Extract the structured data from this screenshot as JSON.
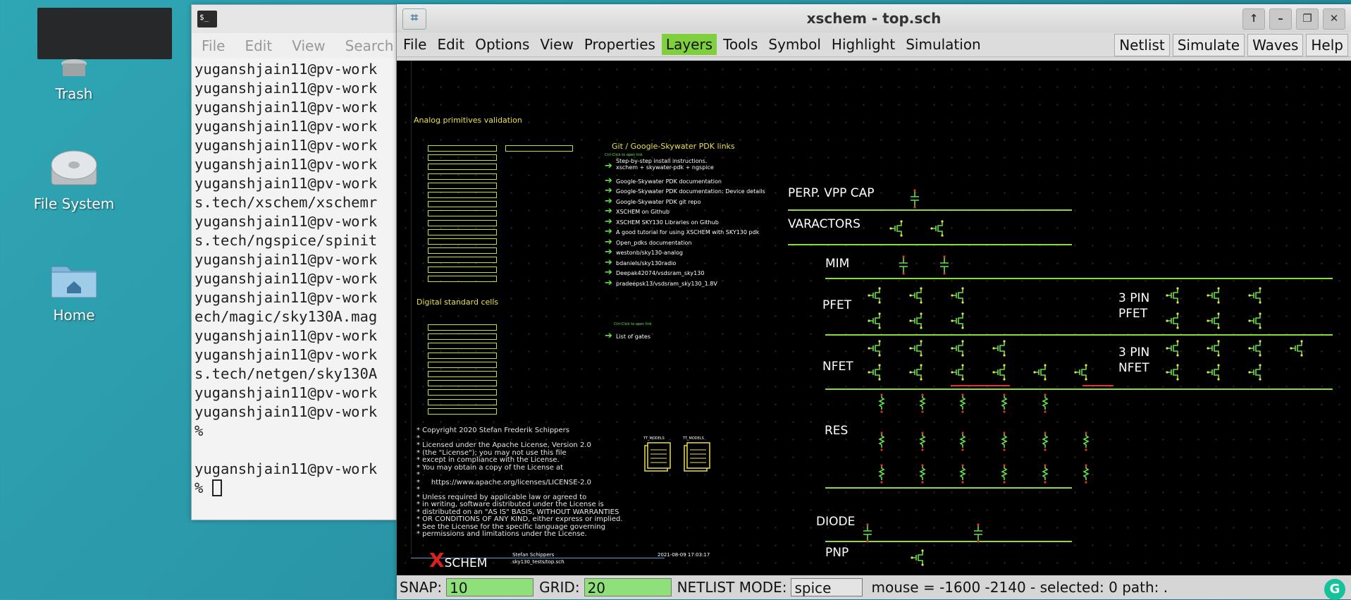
{
  "desktop": {
    "icons": [
      {
        "name": "trash-icon",
        "label": "Trash"
      },
      {
        "name": "file-system-icon",
        "label": "File System"
      },
      {
        "name": "home-folder-icon",
        "label": "Home"
      }
    ]
  },
  "terminal": {
    "menu": [
      "File",
      "Edit",
      "View",
      "Search"
    ],
    "lines": [
      "yuganshjain11@pv-work",
      "yuganshjain11@pv-work",
      "yuganshjain11@pv-work",
      "yuganshjain11@pv-work",
      "yuganshjain11@pv-work",
      "yuganshjain11@pv-work",
      "yuganshjain11@pv-work",
      "s.tech/xschem/xschemr",
      "yuganshjain11@pv-work",
      "s.tech/ngspice/spinit",
      "yuganshjain11@pv-work",
      "yuganshjain11@pv-work",
      "yuganshjain11@pv-work",
      "ech/magic/sky130A.mag",
      "yuganshjain11@pv-work",
      "yuganshjain11@pv-work",
      "s.tech/netgen/sky130A",
      "yuganshjain11@pv-work",
      "yuganshjain11@pv-work",
      "%",
      "",
      "yuganshjain11@pv-work",
      "% "
    ]
  },
  "xschem": {
    "title": "xschem - top.sch",
    "menu": [
      "File",
      "Edit",
      "Options",
      "View",
      "Properties",
      "Layers",
      "Tools",
      "Symbol",
      "Highlight",
      "Simulation"
    ],
    "active_menu": "Layers",
    "right_buttons": [
      "Netlist",
      "Simulate",
      "Waves",
      "Help"
    ],
    "status": {
      "snap_label": "SNAP:",
      "snap_value": "10",
      "grid_label": "GRID:",
      "grid_value": "20",
      "netlist_label": "NETLIST MODE:",
      "netlist_value": "spice",
      "mouse_text": "mouse = -1600 -2140 - selected: 0 path: ."
    },
    "schematic": {
      "analog_title": "Analog primitives validation",
      "digital_title": "Digital standard cells",
      "links_title": "Git / Google-Skywater PDK links",
      "ctrl_click_1": "Ctrl-Click to open link",
      "ctrl_click_2": "Ctrl-Click to open link",
      "links": [
        "Step-by-step install instructions. xschem + skywater-pdk + ngspice",
        "Google-Skywater PDK documentation",
        "Google-Skywater PDK documentation: Device details",
        "Google-Skywater PDK git repo",
        "XSCHEM on Github",
        "XSCHEM SKY130 Libraries on Github",
        "A good tutorial for using XSCHEM with SKY130 pdk",
        "Open_pdks documentation",
        "westonb/sky130-analog",
        "bdaniels/sky130radio",
        "Deepak42074/vsdsram_sky130",
        "pradeepsk13/vsdsram_sky130_1.8V"
      ],
      "list_of_gates": "List of gates",
      "device_labels": [
        "PERP. VPP CAP",
        "VARACTORS",
        "MIM",
        "PFET",
        "NFET",
        "RES",
        "DIODE",
        "PNP",
        "3 PIN PFET",
        "3 PIN NFET"
      ],
      "license": "* Copyright 2020 Stefan Frederik Schippers\n*\n* Licensed under the Apache License, Version 2.0\n* (the \"License\"); you may not use this file\n* except in compliance with the License.\n* You may obtain a copy of the License at\n*\n*     https://www.apache.org/licenses/LICENSE-2.0\n*\n* Unless required by applicable law or agreed to\n* in writing, software distributed under the License is\n* distributed on an \"AS IS\" BASIS, WITHOUT WARRANTIES\n* OR CONDITIONS OF ANY KIND, either express or implied.\n* See the License for the specific language governing\n* permissions and limitations under the License.",
      "logo_text": "SCHEM",
      "author": "Stefan Schippers",
      "file": "sky130_tests/top.sch",
      "date": "2021-08-09  17:03:17",
      "tt_models": [
        "TT_MODELS",
        "TT_MODELS"
      ]
    }
  },
  "colors": {
    "accent_green": "#7fcf3f",
    "wire_green": "#8ed93c",
    "label_yellow": "#e8e04a"
  }
}
